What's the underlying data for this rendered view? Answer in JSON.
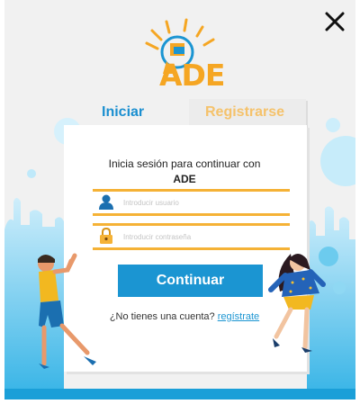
{
  "brand": {
    "name": "ADE"
  },
  "tabs": {
    "login": "Iniciar",
    "register": "Registrarse"
  },
  "form": {
    "subtitle": "Inicia sesión para continuar con",
    "subtitle_brand": "ADE",
    "username_placeholder": "Introducir usuario",
    "password_placeholder": "Introducir contraseña",
    "submit_label": "Continuar"
  },
  "footer": {
    "prompt": "¿No tienes una cuenta?",
    "link": "regístrate"
  },
  "icons": {
    "close": "close-icon",
    "user": "user-icon",
    "lock": "lock-icon",
    "logo": "lightbulb-logo-icon"
  },
  "colors": {
    "primary": "#1b95d2",
    "accent": "#f5a623",
    "tab_inactive": "#f5c26b",
    "background": "#f1f1f1"
  }
}
